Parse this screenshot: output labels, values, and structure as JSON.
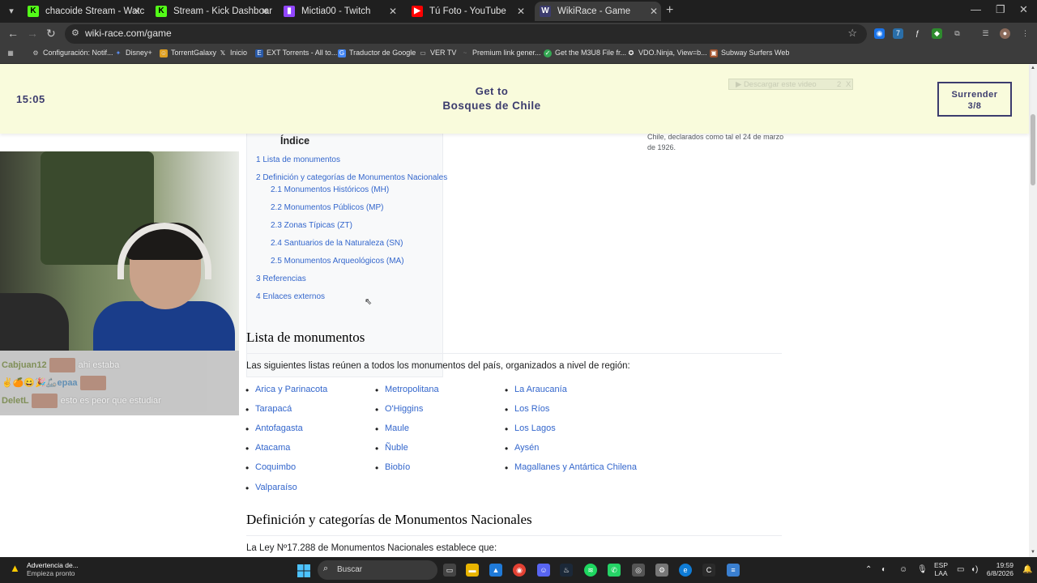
{
  "browser": {
    "tabs": [
      {
        "title": "chacoide Stream - Watch Live o",
        "favicon": "kick-icon"
      },
      {
        "title": "Stream - Kick Dashboard",
        "favicon": "kick-icon"
      },
      {
        "title": "Mictia00 - Twitch",
        "favicon": "twitch-icon"
      },
      {
        "title": "Tú Foto - YouTube",
        "favicon": "youtube-icon"
      },
      {
        "title": "WikiRace - Game",
        "favicon": "wikirace-icon",
        "active": true
      }
    ],
    "url": "wiki-race.com/game",
    "bookmarks": [
      "Configuración: Notif...",
      "Disney+",
      "TorrentGalaxy",
      "Inicio",
      "EXT Torrents - All to...",
      "Traductor de Google",
      "VER TV",
      "Premium link gener...",
      "Get the M3U8 File fr...",
      "VDO.Ninja, View=b...",
      "Subway Surfers Web"
    ]
  },
  "game": {
    "timer": "15:05",
    "goal_prefix": "Get to",
    "goal_target": "Bosques de Chile",
    "download_label": "▶ Descargar este video",
    "download_badge": "2",
    "download_close": "X",
    "surrender_label": "Surrender",
    "surrender_count": "3/8"
  },
  "stream_chat": [
    {
      "user": "Cabjuan12",
      "message": "ahi estaba"
    },
    {
      "user": "✌🍊😄🎉🦾epaa",
      "message": ""
    },
    {
      "user": "DeletL",
      "message": "esto es peor que estudiar"
    }
  ],
  "article": {
    "toc_title": "Índice",
    "toc": [
      "1 Lista de monumentos",
      "2 Definición y categorías de Monumentos Nacionales",
      "2.1 Monumentos Históricos (MH)",
      "2.2 Monumentos Públicos (MP)",
      "2.3 Zonas Típicas (ZT)",
      "2.4 Santuarios de la Naturaleza (SN)",
      "2.5 Monumentos Arqueológicos (MA)",
      "3 Referencias",
      "4 Enlaces externos"
    ],
    "infobox_caption": "Chile, declarados como tal el 24 de marzo de 1926.",
    "section1_title": "Lista de monumentos",
    "section1_intro": "Las siguientes listas reúnen a todos los monumentos del país, organizados a nivel de región:",
    "regions_col1": [
      "Arica y Parinacota",
      "Tarapacá",
      "Antofagasta",
      "Atacama",
      "Coquimbo",
      "Valparaíso"
    ],
    "regions_col2": [
      "Metropolitana",
      "O'Higgins",
      "Maule",
      "Ñuble",
      "Biobío"
    ],
    "regions_col3": [
      "La Araucanía",
      "Los Ríos",
      "Los Lagos",
      "Aysén",
      "Magallanes y Antártica Chilena"
    ],
    "section2_title": "Definición y categorías de Monumentos Nacionales",
    "section2_intro": "La Ley Nº17.288 de Monumentos Nacionales establece que:"
  },
  "taskbar": {
    "alert_title": "Advertencia de...",
    "alert_subtitle": "Empieza pronto",
    "search_placeholder": "Buscar",
    "lang_line1": "ESP",
    "lang_line2": "LAA",
    "time": "19:59",
    "date": "6/8/2026"
  },
  "colors": {
    "header_bg": "#f9fbdc",
    "accent": "#3c3c6e",
    "link": "#3366cc"
  }
}
